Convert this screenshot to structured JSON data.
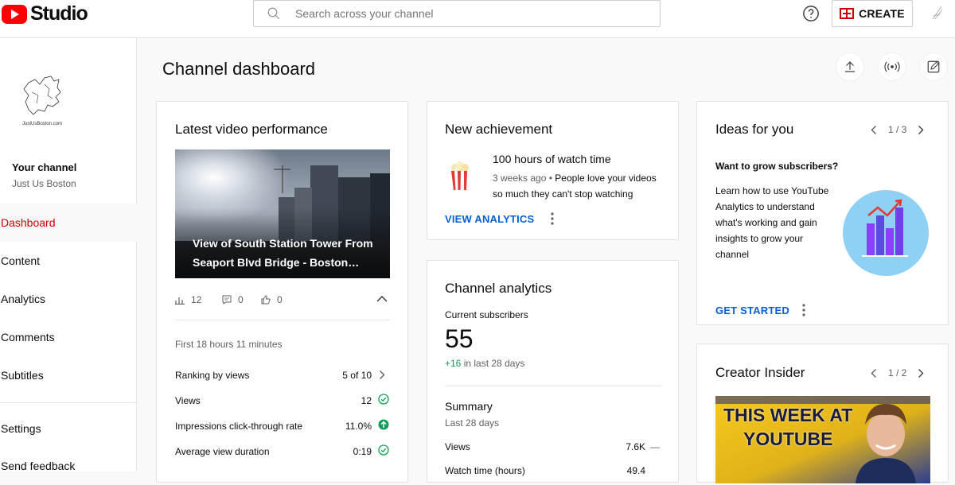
{
  "topbar": {
    "logo_text": "Studio",
    "search_placeholder": "Search across your channel",
    "create_label": "CREATE"
  },
  "sidebar": {
    "channel_logo_caption": "JustUsBoston.com",
    "your_channel": "Your channel",
    "channel_name": "Just Us Boston",
    "items": [
      {
        "label": "Dashboard",
        "active": true
      },
      {
        "label": "Content"
      },
      {
        "label": "Analytics"
      },
      {
        "label": "Comments"
      },
      {
        "label": "Subtitles"
      },
      {
        "label": "Settings"
      },
      {
        "label": "Send feedback"
      }
    ]
  },
  "page": {
    "title": "Channel dashboard"
  },
  "latest_video": {
    "title": "Latest video performance",
    "video_title": "View of South Station Tower From Seaport Blvd Bridge - Boston…",
    "views_count": "12",
    "comments_count": "0",
    "likes_count": "0",
    "period": "First 18 hours 11 minutes",
    "rows": [
      {
        "label": "Ranking by views",
        "value": "5 of 10",
        "icon": "chevron-right-icon"
      },
      {
        "label": "Views",
        "value": "12",
        "icon": "check-circle-icon"
      },
      {
        "label": "Impressions click-through rate",
        "value": "11.0%",
        "icon": "arrow-up-circle-icon"
      },
      {
        "label": "Average view duration",
        "value": "0:19",
        "icon": "check-circle-icon"
      }
    ]
  },
  "achievement": {
    "title": "New achievement",
    "headline": "100 hours of watch time",
    "time_ago": "3 weeks ago",
    "separator": "•",
    "text": "People love your videos so much they can't stop watching",
    "link": "VIEW ANALYTICS"
  },
  "analytics": {
    "title": "Channel analytics",
    "subs_label": "Current subscribers",
    "subs_value": "55",
    "subs_change": "+16",
    "subs_change_suffix": "in last 28 days",
    "summary_title": "Summary",
    "summary_period": "Last 28 days",
    "rows": [
      {
        "label": "Views",
        "value": "7.6K",
        "trend": "—"
      },
      {
        "label": "Watch time (hours)",
        "value": "49.4"
      }
    ]
  },
  "ideas": {
    "title": "Ideas for you",
    "pager": "1 / 3",
    "question": "Want to grow subscribers?",
    "body": "Learn how to use YouTube Analytics to understand what's working and gain insights to grow your channel",
    "link": "GET STARTED"
  },
  "creator_insider": {
    "title": "Creator Insider",
    "pager": "1 / 2",
    "thumb_line1": "THIS WEEK AT",
    "thumb_line2": "YOUTUBE"
  },
  "colors": {
    "accent_red": "#cc0000",
    "link_blue": "#065fd4",
    "positive_green": "#0f9d58"
  }
}
